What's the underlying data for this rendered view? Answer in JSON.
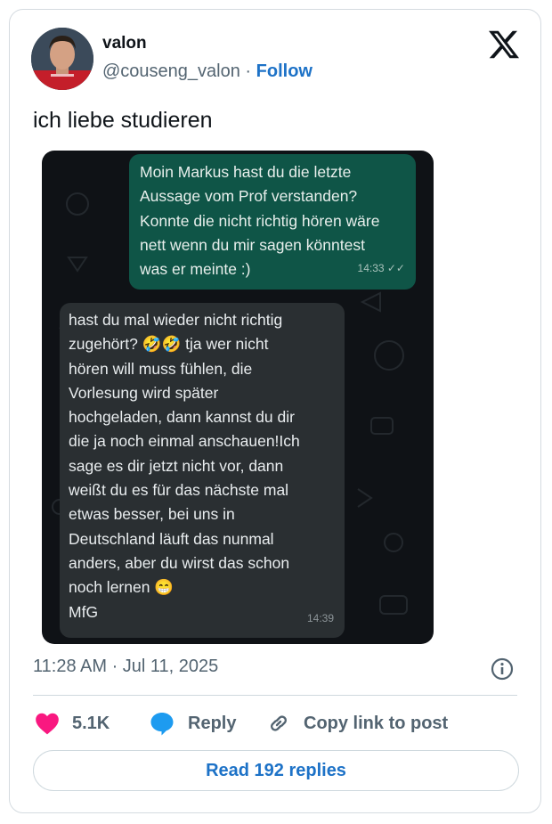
{
  "author": {
    "name": "valon",
    "handle": "@couseng_valon",
    "separator": "·",
    "follow_label": "Follow"
  },
  "tweet": {
    "text": "ich liebe studieren",
    "timestamp": "11:28 AM · Jul 11, 2025"
  },
  "chat": {
    "outgoing": {
      "lines": [
        "Moin Markus hast du die letzte",
        "Aussage vom Prof verstanden?",
        "Konnte die nicht richtig hören wäre",
        "nett wenn du mir sagen könntest",
        "was er meinte :)"
      ],
      "time": "14:33 ✓✓"
    },
    "incoming": {
      "lines": [
        "hast du mal wieder nicht richtig",
        "zugehört? 🤣🤣 tja wer nicht",
        "hören will muss fühlen, die",
        "Vorlesung wird später",
        "hochgeladen, dann kannst du dir",
        "die ja noch einmal anschauen!Ich",
        "sage es dir jetzt nicht vor, dann",
        "weißt du es für das nächste mal",
        "etwas besser, bei uns in",
        "Deutschland läuft das nunmal",
        "anders, aber du wirst das schon",
        "noch lernen 😁",
        "MfG"
      ],
      "time": "14:39"
    }
  },
  "actions": {
    "likes": "5.1K",
    "reply_label": "Reply",
    "copy_label": "Copy link to post",
    "read_replies_label": "Read 192 replies"
  },
  "colors": {
    "accent": "#1d72c7",
    "heart": "#f91880",
    "reply_bubble": "#1d9bf0",
    "outgoing_bubble": "#0f5547",
    "incoming_bubble": "#2a2f32"
  },
  "icons": [
    "x-logo-icon",
    "info-icon",
    "heart-icon",
    "reply-bubble-icon",
    "link-icon",
    "double-check-icon"
  ]
}
